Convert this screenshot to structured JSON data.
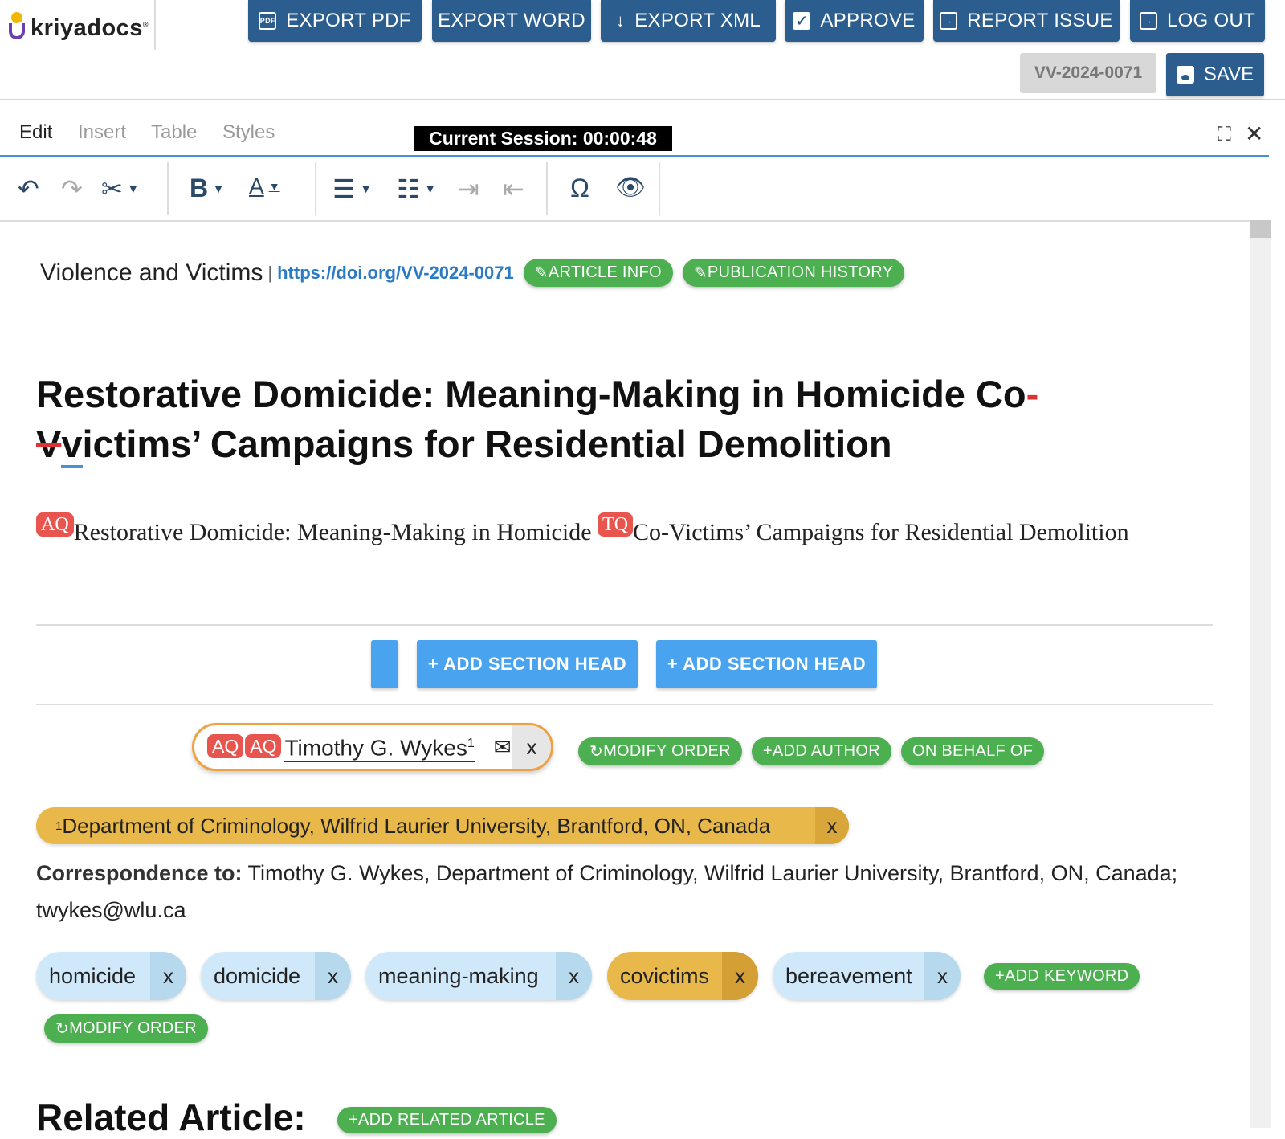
{
  "app": {
    "brand": "kriyadocs",
    "trademark": "®"
  },
  "header": {
    "buttons": [
      {
        "label": "EXPORT PDF",
        "icon": "pdf-icon"
      },
      {
        "label": "EXPORT WORD",
        "icon": ""
      },
      {
        "label": "EXPORT XML",
        "icon": "download-arrow-icon"
      },
      {
        "label": "APPROVE",
        "icon": "check-icon"
      },
      {
        "label": "REPORT ISSUE",
        "icon": "report-icon"
      },
      {
        "label": "LOG OUT",
        "icon": "logout-icon"
      }
    ],
    "doc_id": "VV-2024-0071",
    "save_label": "SAVE"
  },
  "editor": {
    "tabs": [
      "Edit",
      "Insert",
      "Table",
      "Styles"
    ],
    "active_tab": "Edit",
    "session": "Current Session: 00:00:48"
  },
  "article": {
    "journal": "Violence and Victims",
    "doi": "https://doi.org/VV-2024-0071",
    "article_info": "ARTICLE INFO",
    "publication_history": "PUBLICATION HISTORY",
    "title_part1": "Restorative Domicide: Meaning-Making in Homicide Co",
    "title_hyphen": "-",
    "title_deleted": "V",
    "title_inserted": "v",
    "title_part2": "ictims’ Campaigns for Residential Demolition",
    "subtitle_badge1": "AQ",
    "subtitle_part1": "Restorative Domicide: Meaning-Making in Homicide ",
    "subtitle_badge2": "TQ",
    "subtitle_part2": "Co-Victims’ Campaigns for Residential Demolition",
    "section_buttons": [
      "",
      "+ ADD SECTION HEAD",
      "+ ADD SECTION HEAD"
    ],
    "author": {
      "badges": [
        "AQ",
        "AQ"
      ],
      "name": "Timothy G. Wykes",
      "sup": "1",
      "remove": "x"
    },
    "author_actions": [
      "MODIFY ORDER",
      "ADD AUTHOR",
      "ON BEHALF OF"
    ],
    "affiliation": {
      "sup": "1",
      "text": "Department of Criminology, Wilfrid Laurier University, Brantford, ON, Canada",
      "remove": "x"
    },
    "correspondence_label": "Correspondence to:",
    "correspondence_text": " Timothy G. Wykes, Department of Criminology, Wilfrid Laurier University, Brantford, ON, Canada; twykes@wlu.ca",
    "keywords": [
      {
        "label": "homicide",
        "highlight": false
      },
      {
        "label": "domicide",
        "highlight": false
      },
      {
        "label": "meaning-making",
        "highlight": false
      },
      {
        "label": "covictims",
        "highlight": true
      },
      {
        "label": "bereavement",
        "highlight": false
      }
    ],
    "keyword_remove": "x",
    "add_keyword": "ADD KEYWORD",
    "modify_order": "MODIFY ORDER",
    "related_heading": "Related Article:",
    "add_related": "ADD RELATED ARTICLE"
  },
  "colors": {
    "primary": "#2b5e8f",
    "accent_blue": "#4aa3ee",
    "green": "#4caf50",
    "badge_red": "#e8554e",
    "gold": "#e9b84a",
    "keyword_blue": "#cfe9fb"
  }
}
